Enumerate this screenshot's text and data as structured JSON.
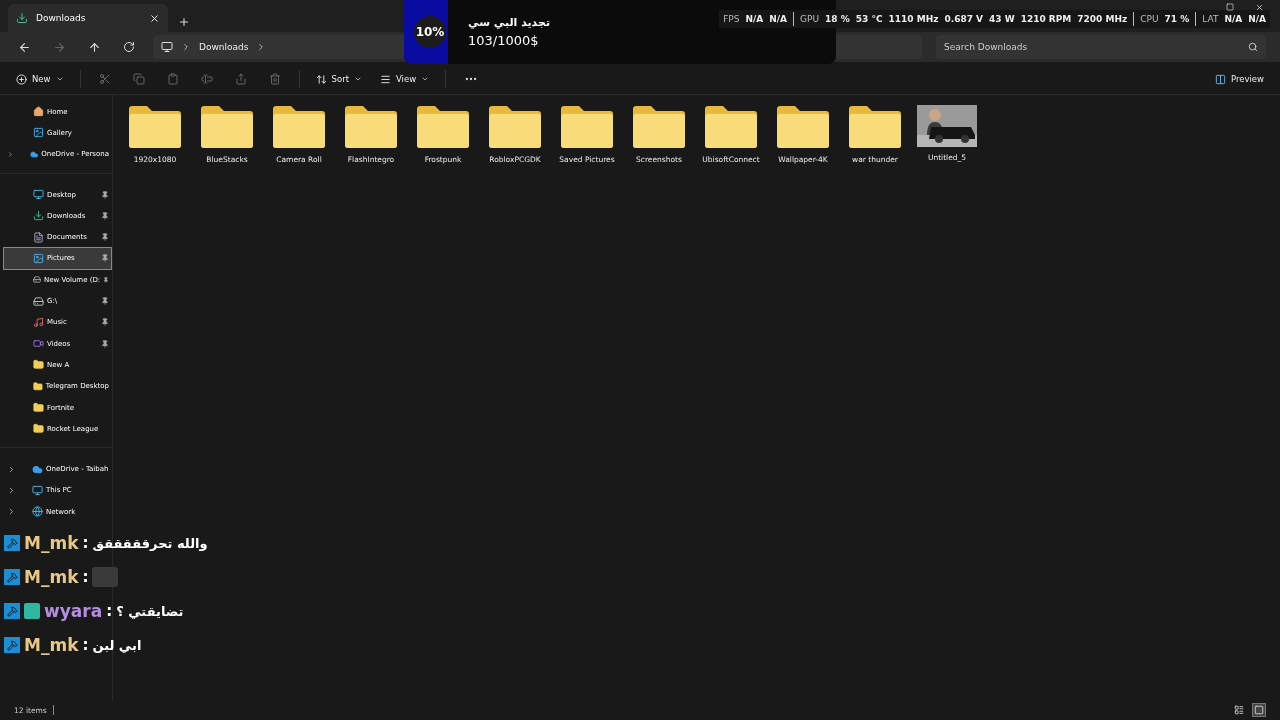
{
  "tab": {
    "title": "Downloads"
  },
  "goal": {
    "percent": "10%",
    "title": "تجديد البي سي",
    "amount": "103/1000$"
  },
  "stats": [
    {
      "label": "FPS",
      "values": [
        "N/A",
        "N/A"
      ]
    },
    {
      "label": "GPU",
      "values": [
        "18 %",
        "53 °C",
        "1110 MHz",
        "0.687 V",
        "43 W",
        "1210 RPM",
        "7200 MHz"
      ]
    },
    {
      "label": "CPU",
      "values": [
        "71 %"
      ]
    },
    {
      "label": "LAT",
      "values": [
        "N/A",
        "N/A"
      ]
    }
  ],
  "breadcrumb": [
    "Downloads"
  ],
  "search": {
    "placeholder": "Search Downloads"
  },
  "toolbar": {
    "new": "New",
    "sort": "Sort",
    "view": "View",
    "preview": "Preview"
  },
  "sidebar": [
    [
      {
        "label": "Home",
        "kind": "home",
        "pinned": false,
        "selected": false,
        "expandable": false
      },
      {
        "label": "Gallery",
        "kind": "gallery",
        "pinned": false,
        "selected": false,
        "expandable": false
      },
      {
        "label": "OneDrive - Persona",
        "kind": "cloud",
        "pinned": false,
        "selected": false,
        "expandable": true
      }
    ],
    [
      {
        "label": "Desktop",
        "kind": "desktop",
        "pinned": true,
        "selected": false,
        "expandable": false
      },
      {
        "label": "Downloads",
        "kind": "download",
        "pinned": true,
        "selected": false,
        "expandable": false
      },
      {
        "label": "Documents",
        "kind": "document",
        "pinned": true,
        "selected": false,
        "expandable": false
      },
      {
        "label": "Pictures",
        "kind": "gallery",
        "pinned": true,
        "selected": true,
        "expandable": false
      },
      {
        "label": "New Volume (D:",
        "kind": "drive",
        "pinned": true,
        "selected": false,
        "expandable": false
      },
      {
        "label": "G:\\",
        "kind": "drive",
        "pinned": true,
        "selected": false,
        "expandable": false
      },
      {
        "label": "Music",
        "kind": "music",
        "pinned": true,
        "selected": false,
        "expandable": false
      },
      {
        "label": "Videos",
        "kind": "video",
        "pinned": true,
        "selected": false,
        "expandable": false
      },
      {
        "label": "New A",
        "kind": "folder",
        "pinned": false,
        "selected": false,
        "expandable": false
      },
      {
        "label": "Telegram Desktop",
        "kind": "folder",
        "pinned": false,
        "selected": false,
        "expandable": false
      },
      {
        "label": "Fortnite",
        "kind": "folder",
        "pinned": false,
        "selected": false,
        "expandable": false
      },
      {
        "label": "Rocket League",
        "kind": "folder",
        "pinned": false,
        "selected": false,
        "expandable": false
      }
    ],
    [
      {
        "label": "OneDrive - Taibah",
        "kind": "cloud",
        "pinned": false,
        "selected": false,
        "expandable": true
      },
      {
        "label": "This PC",
        "kind": "desktop",
        "pinned": false,
        "selected": false,
        "expandable": true
      },
      {
        "label": "Network",
        "kind": "network",
        "pinned": false,
        "selected": false,
        "expandable": true
      }
    ]
  ],
  "files": [
    {
      "name": "1920x1080",
      "kind": "folder"
    },
    {
      "name": "BlueStacks",
      "kind": "folder"
    },
    {
      "name": "Camera Roll",
      "kind": "folder"
    },
    {
      "name": "FlashIntegro",
      "kind": "folder"
    },
    {
      "name": "Frostpunk",
      "kind": "folder"
    },
    {
      "name": "RobloxPCGDK",
      "kind": "folder"
    },
    {
      "name": "Saved Pictures",
      "kind": "folder"
    },
    {
      "name": "Screenshots",
      "kind": "folder"
    },
    {
      "name": "UbisoftConnect",
      "kind": "folder"
    },
    {
      "name": "Wallpaper-4K",
      "kind": "folder"
    },
    {
      "name": "war thunder",
      "kind": "folder"
    },
    {
      "name": "Untitled_5",
      "kind": "picture"
    }
  ],
  "chat": [
    {
      "user": "M_mk",
      "color": "#e8c887",
      "separator": ":",
      "kind": "text",
      "message": "والله تحرقققققق",
      "badge": false
    },
    {
      "user": "M_mk",
      "color": "#e8c887",
      "separator": ":",
      "kind": "sticker",
      "badge": false
    },
    {
      "user": "wyara",
      "color": "#b58ee0",
      "separator": ":",
      "kind": "text",
      "message": "تضايقتي ؟",
      "badge": true
    },
    {
      "user": "M_mk",
      "color": "#e8c887",
      "separator": ":",
      "kind": "text",
      "message": "ابي لبن",
      "badge": false
    }
  ],
  "status": {
    "count": "12 items"
  },
  "views": [
    {
      "kind": "details",
      "selected": false
    },
    {
      "kind": "tiles",
      "selected": true
    }
  ]
}
